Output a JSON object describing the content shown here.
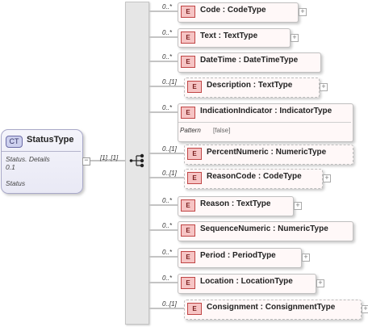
{
  "complex_type": {
    "badge": "CT",
    "name": "StatusType",
    "doc_lines": [
      "Status. Details",
      "0.1",
      "Status"
    ]
  },
  "sequence": {
    "cardinality": "[1]..[1]"
  },
  "elements": [
    {
      "occurs": "0..*",
      "name": "Code",
      "type": "CodeType",
      "optional": false,
      "expandable": true
    },
    {
      "occurs": "0..*",
      "name": "Text",
      "type": "TextType",
      "optional": false,
      "expandable": true
    },
    {
      "occurs": "0..*",
      "name": "DateTime",
      "type": "DateTimeType",
      "optional": false,
      "expandable": false
    },
    {
      "occurs": "0..[1]",
      "name": "Description",
      "type": "TextType",
      "optional": true,
      "expandable": true
    },
    {
      "occurs": "0..*",
      "name": "IndicationIndicator",
      "type": "IndicatorType",
      "optional": false,
      "expandable": false,
      "facet": {
        "label": "Pattern",
        "value": "[false]"
      }
    },
    {
      "occurs": "0..[1]",
      "name": "PercentNumeric",
      "type": "NumericType",
      "optional": true,
      "expandable": false
    },
    {
      "occurs": "0..[1]",
      "name": "ReasonCode",
      "type": "CodeType",
      "optional": true,
      "expandable": true
    },
    {
      "occurs": "0..*",
      "name": "Reason",
      "type": "TextType",
      "optional": false,
      "expandable": true
    },
    {
      "occurs": "0..*",
      "name": "SequenceNumeric",
      "type": "NumericType",
      "optional": false,
      "expandable": false
    },
    {
      "occurs": "0..*",
      "name": "Period",
      "type": "PeriodType",
      "optional": false,
      "expandable": true
    },
    {
      "occurs": "0..*",
      "name": "Location",
      "type": "LocationType",
      "optional": false,
      "expandable": true
    },
    {
      "occurs": "0..[1]",
      "name": "Consignment",
      "type": "ConsignmentType",
      "optional": true,
      "expandable": true
    }
  ],
  "element_badge": "E",
  "separator": ":",
  "expand_symbol": "+",
  "collapse_symbol": "−"
}
